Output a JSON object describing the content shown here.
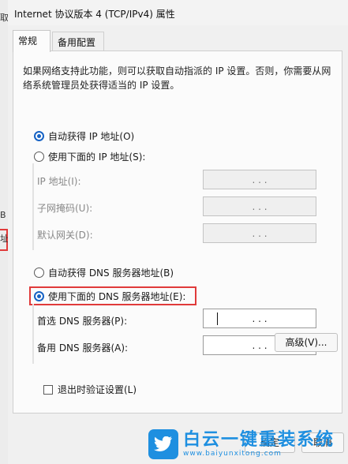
{
  "background": {
    "frag_top": "取",
    "frag_mid": "B",
    "frag_low": "址"
  },
  "window": {
    "title": "Internet 协议版本 4 (TCP/IPv4) 属性"
  },
  "tabs": [
    {
      "label": "常规"
    },
    {
      "label": "备用配置"
    }
  ],
  "description": "如果网络支持此功能，则可以获取自动指派的 IP 设置。否则，你需要从网络系统管理员处获得适当的 IP 设置。",
  "ip_section": {
    "auto_label": "自动获得 IP 地址(O)",
    "manual_label": "使用下面的 IP 地址(S):",
    "fields": [
      {
        "label": "IP 地址(I):",
        "value": ".   .   ."
      },
      {
        "label": "子网掩码(U):",
        "value": ".   .   ."
      },
      {
        "label": "默认网关(D):",
        "value": ".   .   ."
      }
    ]
  },
  "dns_section": {
    "auto_label": "自动获得 DNS 服务器地址(B)",
    "manual_label": "使用下面的 DNS 服务器地址(E):",
    "fields": [
      {
        "label": "首选 DNS 服务器(P):",
        "value": ".   .   ."
      },
      {
        "label": "备用 DNS 服务器(A):",
        "value": ".   .   ."
      }
    ]
  },
  "validate_label": "退出时验证设置(L)",
  "advanced_button": "高级(V)...",
  "ok_button": "确定",
  "cancel_button": "取消",
  "watermark": {
    "title": "白云一键重装系统",
    "url": "www.baiyunxitong.com"
  },
  "colors": {
    "accent": "#1662c4",
    "highlight": "#e03a3a",
    "watermark": "#1e8fe0"
  }
}
